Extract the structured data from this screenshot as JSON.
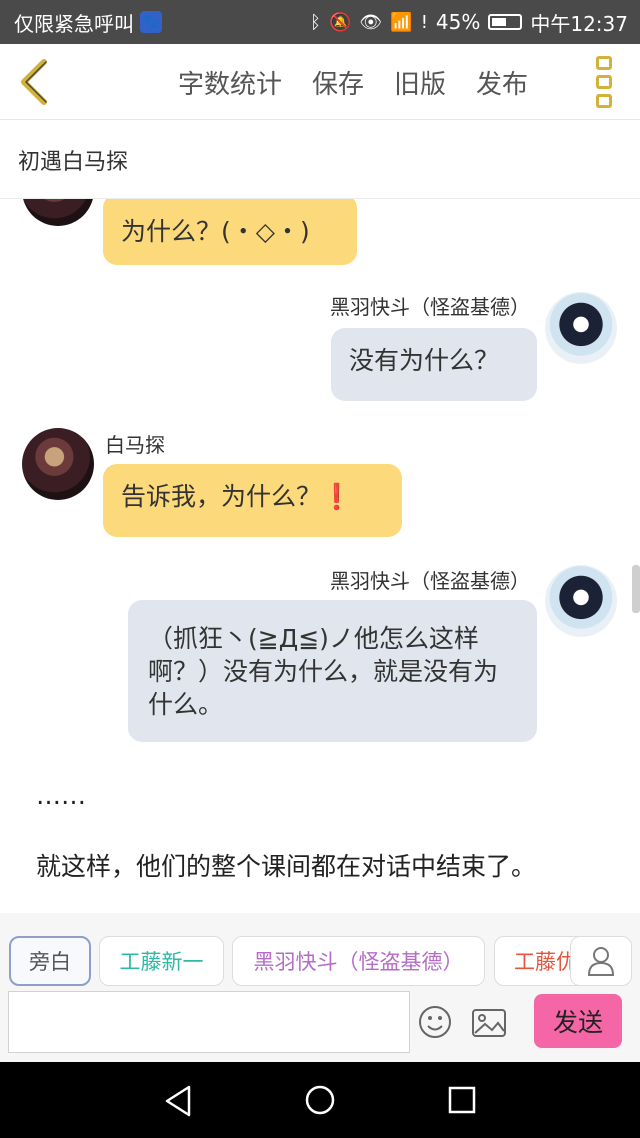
{
  "status_bar": {
    "left_text": "仅限紧急呼叫",
    "battery": "45%",
    "time": "中午12:37",
    "icons": [
      "baidu-paw-icon",
      "bluetooth-icon",
      "mute-icon",
      "eye-icon",
      "wifi-icon",
      "alert-icon",
      "battery-icon"
    ]
  },
  "header": {
    "actions": [
      "字数统计",
      "保存",
      "旧版",
      "发布"
    ],
    "back_icon": "chevron-left-icon",
    "more_icon": "vertical-dots-icon",
    "accent_color": "#d4b23a"
  },
  "story": {
    "title": "初遇白马探"
  },
  "messages": [
    {
      "side": "left",
      "speaker": "",
      "text": "为什么？(・◇・)",
      "bubble_color": "#fcd97a"
    },
    {
      "side": "right",
      "speaker": "黑羽快斗（怪盗基德）",
      "text": "没有为什么？",
      "bubble_color": "#e1e6ee"
    },
    {
      "side": "left",
      "speaker": "白马探",
      "text": "告诉我，为什么？",
      "emoji": "❗",
      "bubble_color": "#fcd97a"
    },
    {
      "side": "right",
      "speaker": "黑羽快斗（怪盗基德）",
      "text": "（抓狂丶(≧Д≦)ノ他怎么这样啊？）没有为什么，就是没有为什么。",
      "bubble_color": "#e1e6ee"
    }
  ],
  "narration": [
    "……",
    "就这样，他们的整个课间都在对话中结束了。"
  ],
  "roles": [
    {
      "label": "旁白",
      "color": "#555555",
      "active": true
    },
    {
      "label": "工藤新一",
      "color": "#2fb8a6",
      "active": false
    },
    {
      "label": "黑羽快斗（怪盗基德）",
      "color": "#b56cc9",
      "active": false
    },
    {
      "label": "工藤优",
      "color": "#e5553e",
      "active": false
    }
  ],
  "input": {
    "value": "",
    "placeholder": "",
    "send_label": "发送",
    "send_color": "#f566a6"
  }
}
